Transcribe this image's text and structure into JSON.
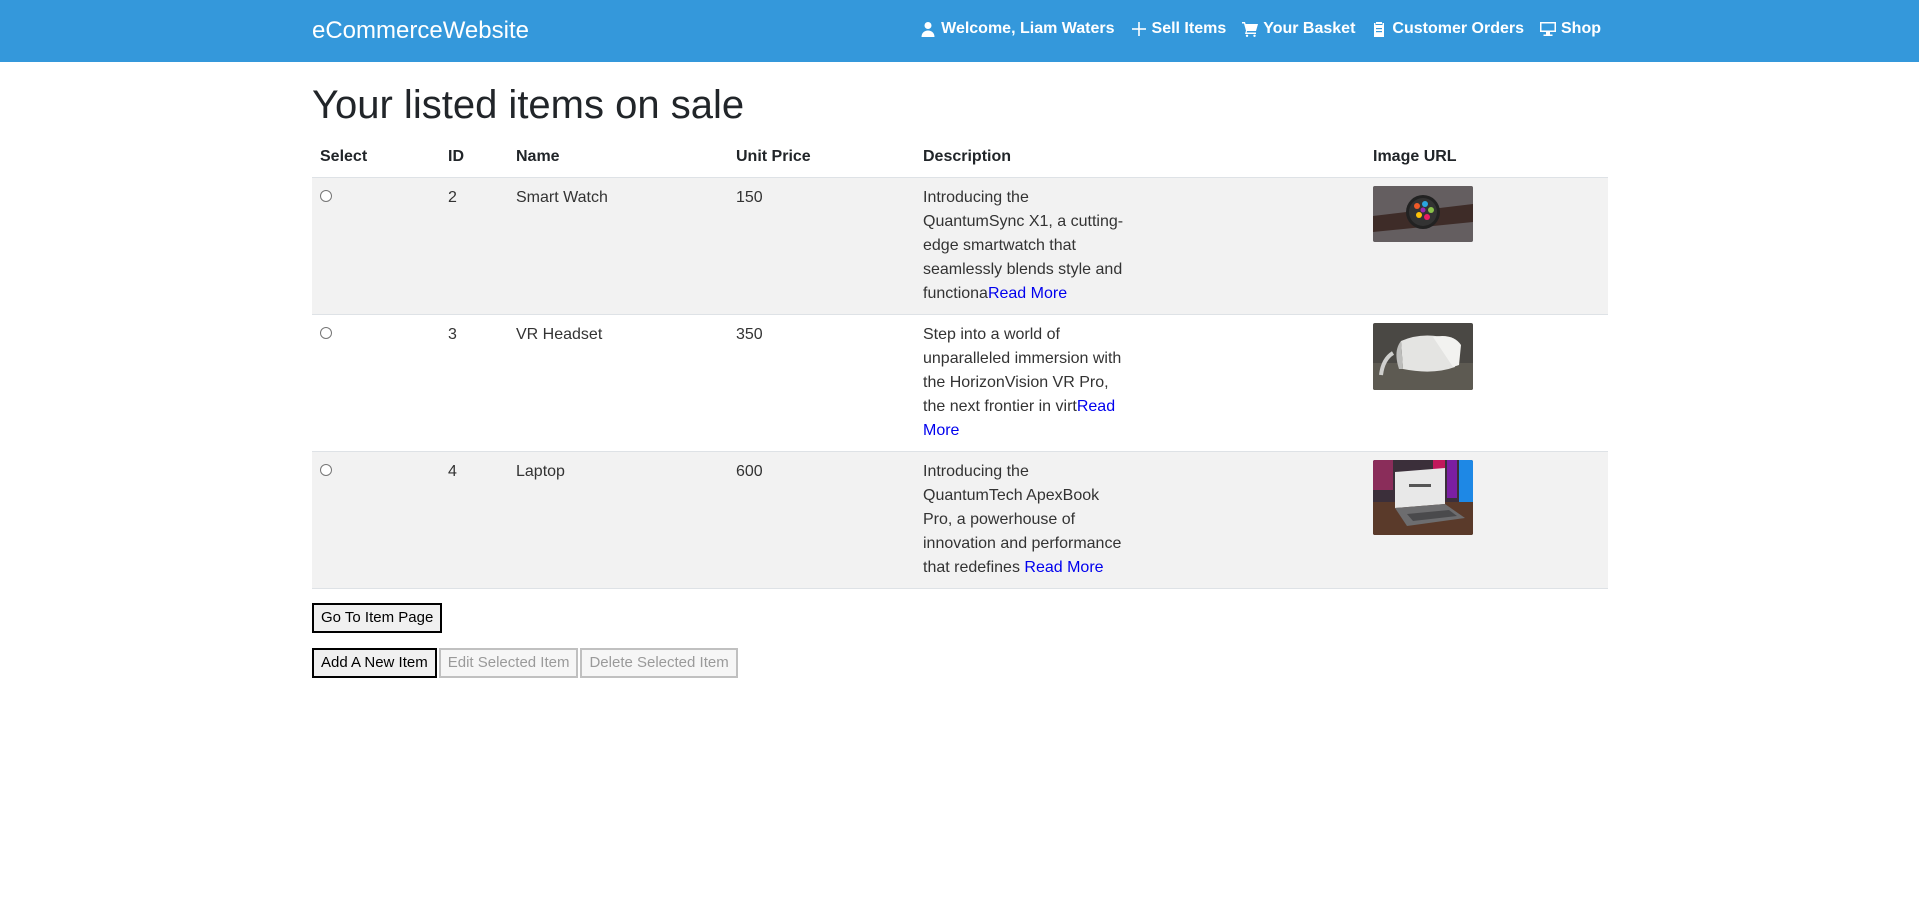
{
  "navbar": {
    "brand": "eCommerceWebsite",
    "links": [
      {
        "label": "Welcome, Liam Waters",
        "icon": "user-icon"
      },
      {
        "label": "Sell Items",
        "icon": "plus-icon"
      },
      {
        "label": "Your Basket",
        "icon": "cart-icon"
      },
      {
        "label": "Customer Orders",
        "icon": "clipboard-icon"
      },
      {
        "label": "Shop",
        "icon": "monitor-icon"
      }
    ],
    "color": "#3498db"
  },
  "page_title": "Your listed items on sale",
  "table": {
    "headers": [
      "Select",
      "ID",
      "Name",
      "Unit Price",
      "Description",
      "Image URL"
    ],
    "rows": [
      {
        "id": "2",
        "name": "Smart Watch",
        "price": "150",
        "description": "Introducing the QuantumSync X1, a cutting-edge smartwatch that seamlessly blends style and functiona",
        "read_more": "Read More",
        "image": "smartwatch-photo"
      },
      {
        "id": "3",
        "name": "VR Headset",
        "price": "350",
        "description": "Step into a world of unparalleled immersion with the HorizonVision VR Pro, the next frontier in virt",
        "read_more": "Read More",
        "image": "vr-headset-photo"
      },
      {
        "id": "4",
        "name": "Laptop",
        "price": "600",
        "description": "Introducing the QuantumTech ApexBook Pro, a powerhouse of innovation and performance that redefines ",
        "read_more": "Read More",
        "image": "laptop-photo"
      }
    ]
  },
  "buttons": {
    "go_to_item": "Go To Item Page",
    "add_item": "Add A New Item",
    "edit_item": "Edit Selected Item",
    "delete_item": "Delete Selected Item"
  }
}
